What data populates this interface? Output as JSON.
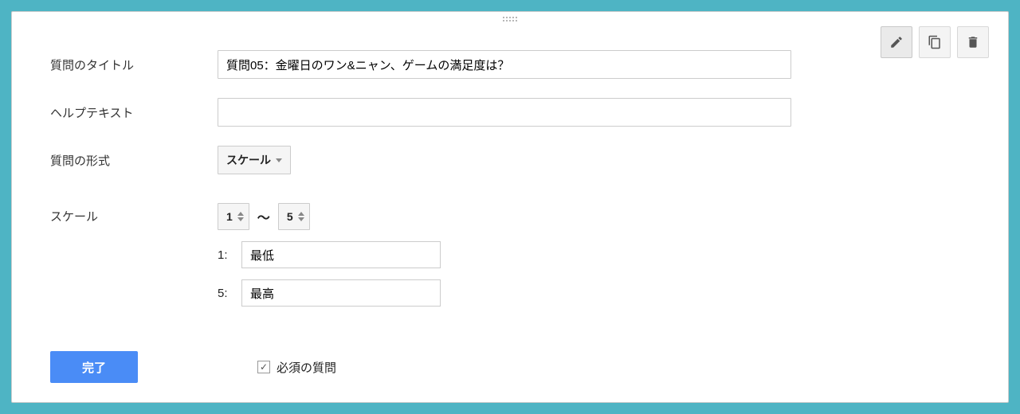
{
  "labels": {
    "question_title": "質問のタイトル",
    "help_text": "ヘルプテキスト",
    "question_type": "質問の形式",
    "scale": "スケール"
  },
  "values": {
    "title": "質問05：金曜日のワン&ニャン、ゲームの満足度は？",
    "help": "",
    "type": "スケール",
    "scale_min": "1",
    "scale_max": "5",
    "range_separator": "〜",
    "min_colon": "1:",
    "max_colon": "5:",
    "min_label": "最低",
    "max_label": "最高"
  },
  "footer": {
    "done": "完了",
    "required_checked": true,
    "required_label": "必須の質問"
  },
  "icons": {
    "edit": "edit-icon",
    "copy": "copy-icon",
    "delete": "trash-icon"
  }
}
